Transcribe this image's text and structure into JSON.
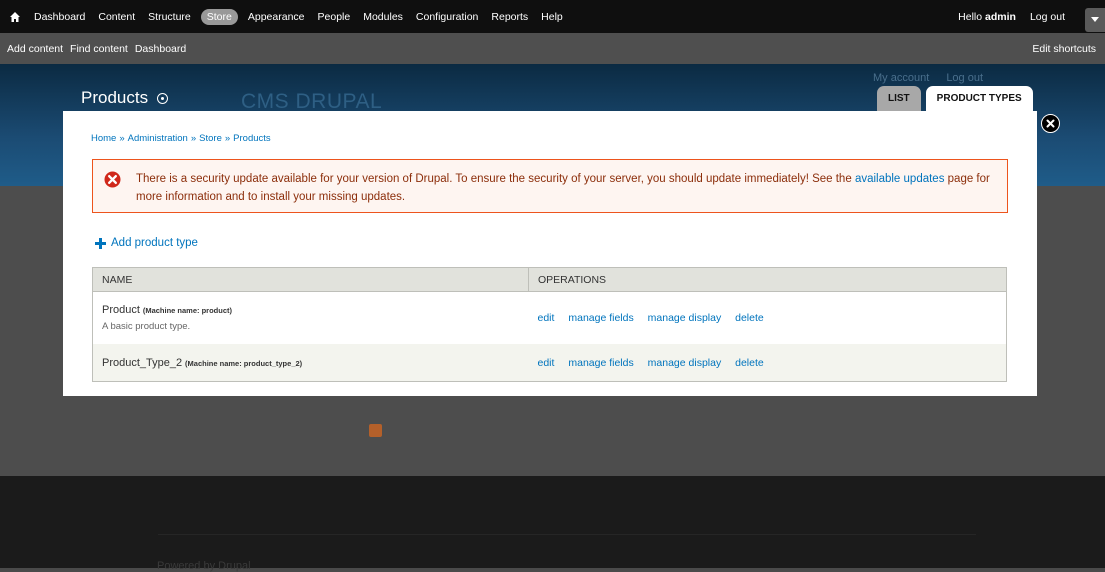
{
  "toolbar": {
    "items": [
      "Dashboard",
      "Content",
      "Structure",
      "Store",
      "Appearance",
      "People",
      "Modules",
      "Configuration",
      "Reports",
      "Help"
    ],
    "hello_prefix": "Hello",
    "username": "admin",
    "logout": "Log out"
  },
  "shortcuts": {
    "items": [
      "Add content",
      "Find content",
      "Dashboard"
    ],
    "edit": "Edit shortcuts"
  },
  "header": {
    "site_name": "CMS DRUPAL",
    "my_account": "My account",
    "log_out": "Log out"
  },
  "overlay": {
    "title": "Products",
    "tabs": [
      "LIST",
      "PRODUCT TYPES"
    ],
    "breadcrumb": [
      "Home",
      "Administration",
      "Store",
      "Products"
    ],
    "breadcrumb_separator": "»",
    "message": {
      "before_link": "There is a security update available for your version of Drupal. To ensure the security of your server, you should update immediately! See the",
      "link": "available updates",
      "after_link": "page for more information and to install your missing updates."
    },
    "add_link": "Add product type",
    "table": {
      "headers": [
        "NAME",
        "OPERATIONS"
      ],
      "rows": [
        {
          "name": "Product",
          "machine": "(Machine name: product)",
          "description": "A basic product type.",
          "ops": [
            "edit",
            "manage fields",
            "manage display",
            "delete"
          ]
        },
        {
          "name": "Product_Type_2",
          "machine": "(Machine name: product_type_2)",
          "description": "",
          "ops": [
            "edit",
            "manage fields",
            "manage display",
            "delete"
          ]
        }
      ]
    }
  },
  "footer": {
    "powered": "Powered by Drupal"
  },
  "colors": {
    "toolbar_bg": "#0f0f0f",
    "shortcut_bg": "#4f4f4f",
    "link": "#0074bd",
    "error_border": "#ed541d",
    "error_text": "#8c2e0b"
  },
  "icons": [
    "home-icon",
    "close-icon",
    "error-icon",
    "plus-icon",
    "rss-icon"
  ]
}
